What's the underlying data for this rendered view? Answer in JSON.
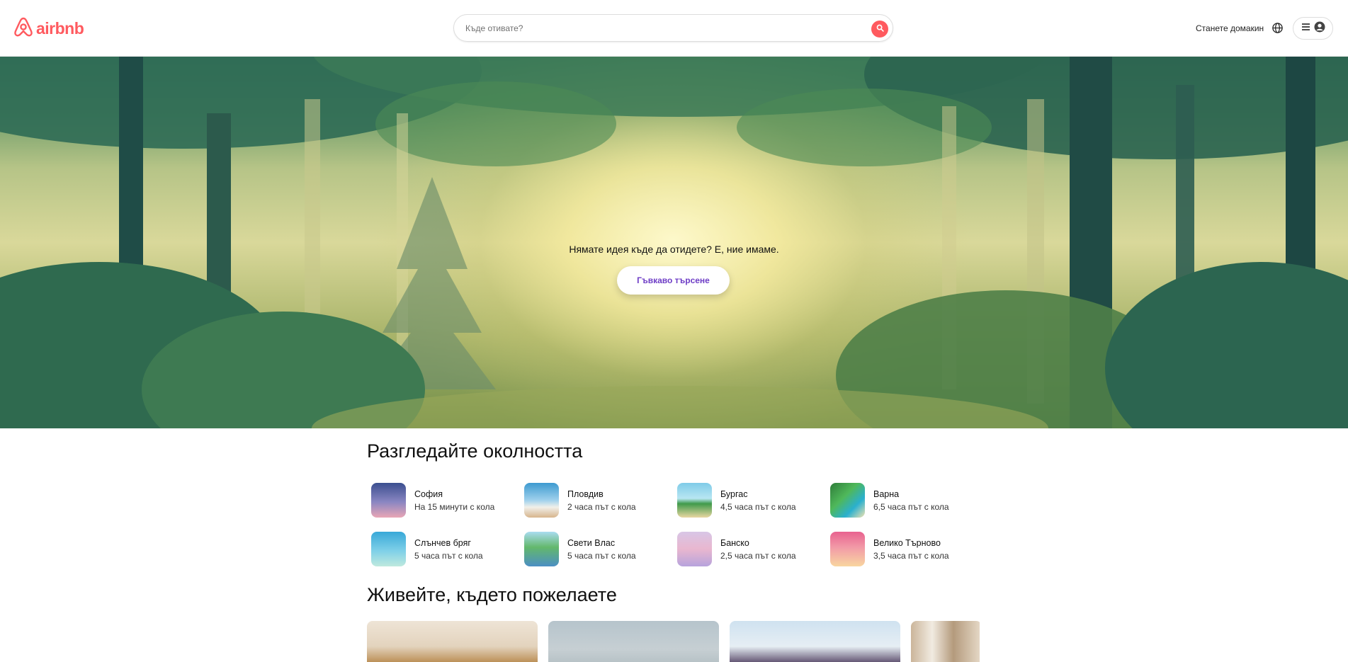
{
  "header": {
    "logo_text": "airbnb",
    "search_placeholder": "Къде отивате?",
    "host_link": "Станете домакин",
    "icons": [
      "airbnb-logo-icon",
      "search-icon",
      "globe-icon",
      "menu-icon",
      "user-icon"
    ]
  },
  "hero": {
    "caption": "Нямате идея къде да отидете? Е, ние имаме.",
    "button_label": "Гъвкаво търсене"
  },
  "explore": {
    "title": "Разгледайте околността",
    "places": [
      {
        "name": "София",
        "distance": "На 15 минути с кола"
      },
      {
        "name": "Пловдив",
        "distance": "2 часа път с кола"
      },
      {
        "name": "Бургас",
        "distance": "4,5 часа път с кола"
      },
      {
        "name": "Варна",
        "distance": "6,5 часа път с кола"
      },
      {
        "name": "Слънчев бряг",
        "distance": "5 часа път с кола"
      },
      {
        "name": "Свети Влас",
        "distance": "5 часа път с кола"
      },
      {
        "name": "Банско",
        "distance": "2,5 часа път с кола"
      },
      {
        "name": "Велико Търново",
        "distance": "3,5 часа път с кола"
      }
    ]
  },
  "live": {
    "title": "Живейте, където пожелаете"
  },
  "colors": {
    "brand": "#ff5a5f",
    "flexible_button_text": "#6e3dc6"
  }
}
